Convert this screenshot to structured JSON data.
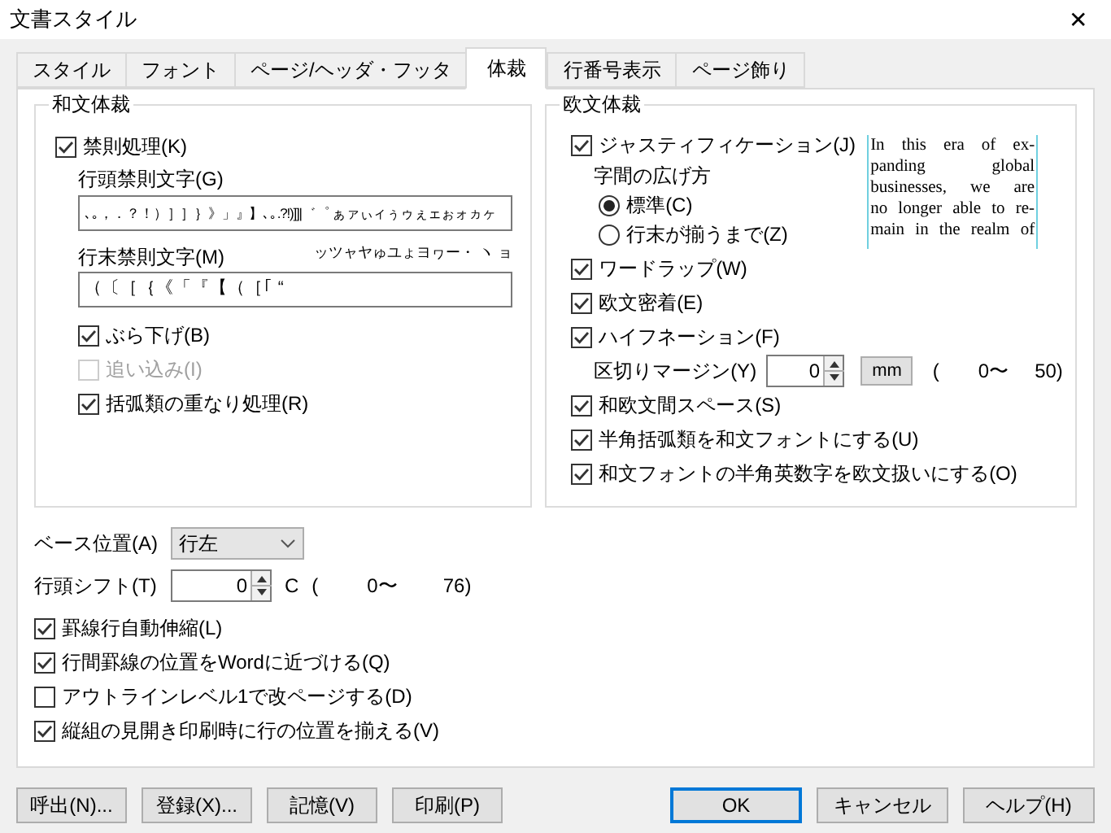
{
  "window": {
    "title": "文書スタイル",
    "close": "✕"
  },
  "tabs": [
    {
      "label": "スタイル",
      "selected": false
    },
    {
      "label": "フォント",
      "selected": false
    },
    {
      "label": "ページ/ヘッダ・フッタ",
      "selected": false
    },
    {
      "label": "体裁",
      "selected": true
    },
    {
      "label": "行番号表示",
      "selected": false
    },
    {
      "label": "ページ飾り",
      "selected": false
    }
  ],
  "japanese_layout": {
    "title": "和文体裁",
    "kinsoku": {
      "label": "禁則処理(K)",
      "checked": true
    },
    "line_head": {
      "label": "行頭禁則文字(G)",
      "value": "､｡，．？！）］］｝》」』】､｡.?!)]]|゛゜ ぁァぃィぅゥぇェぉォヵヶ",
      "overflow": "ッツャヤゅユょヨヮー・ ヽ ョ"
    },
    "line_end": {
      "label": "行末禁則文字(M)",
      "value": "（〔［｛《「『【（［｢ “"
    },
    "options": [
      {
        "label": "ぶら下げ(B)",
        "checked": true,
        "disabled": false
      },
      {
        "label": "追い込み(I)",
        "checked": false,
        "disabled": true
      },
      {
        "label": "括弧類の重なり処理(R)",
        "checked": true,
        "disabled": false
      }
    ]
  },
  "western_layout": {
    "title": "欧文体裁",
    "justification": {
      "label": "ジャスティフィケーション(J)",
      "checked": true
    },
    "spacing_label": "字間の広げ方",
    "spacing_options": [
      {
        "label": "標準(C)",
        "selected": true
      },
      {
        "label": "行末が揃うまで(Z)",
        "selected": false
      }
    ],
    "preview_lines": [
      "In this era of ex-",
      "panding global",
      "businesses, we are",
      "no longer able to re-",
      "main in the realm of"
    ],
    "options": [
      {
        "kind": "checkbox",
        "label": "ワードラップ(W)",
        "checked": true
      },
      {
        "kind": "checkbox",
        "label": "欧文密着(E)",
        "checked": true
      },
      {
        "kind": "checkbox",
        "label": "ハイフネーション(F)",
        "checked": true
      },
      {
        "kind": "margin",
        "label": "区切りマージン(Y)",
        "value": "0",
        "unit": "mm",
        "open": "(",
        "min": "0〜",
        "max": "50)"
      },
      {
        "kind": "checkbox",
        "label": "和欧文間スペース(S)",
        "checked": true
      },
      {
        "kind": "checkbox",
        "label": "半角括弧類を和文フォントにする(U)",
        "checked": true
      },
      {
        "kind": "checkbox",
        "label": "和文フォントの半角英数字を欧文扱いにする(O)",
        "checked": true
      }
    ]
  },
  "base_position": {
    "label": "ベース位置(A)",
    "value": "行左"
  },
  "line_head_shift": {
    "label": "行頭シフト(T)",
    "value": "0",
    "unit": "C",
    "open": "(",
    "min": "0〜",
    "max": "76)"
  },
  "options": [
    {
      "label": "罫線行自動伸縮(L)",
      "checked": true
    },
    {
      "label": "行間罫線の位置をWordに近づける(Q)",
      "checked": true
    },
    {
      "label": "アウトラインレベル1で改ページする(D)",
      "checked": false
    },
    {
      "label": "縦組の見開き印刷時に行の位置を揃える(V)",
      "checked": true
    }
  ],
  "buttons_left": [
    "呼出(N)...",
    "登録(X)...",
    "記憶(V)",
    "印刷(P)"
  ],
  "buttons_right": [
    {
      "label": "OK",
      "default": true
    },
    {
      "label": "キャンセル",
      "default": false
    },
    {
      "label": "ヘルプ(H)",
      "default": false
    }
  ]
}
